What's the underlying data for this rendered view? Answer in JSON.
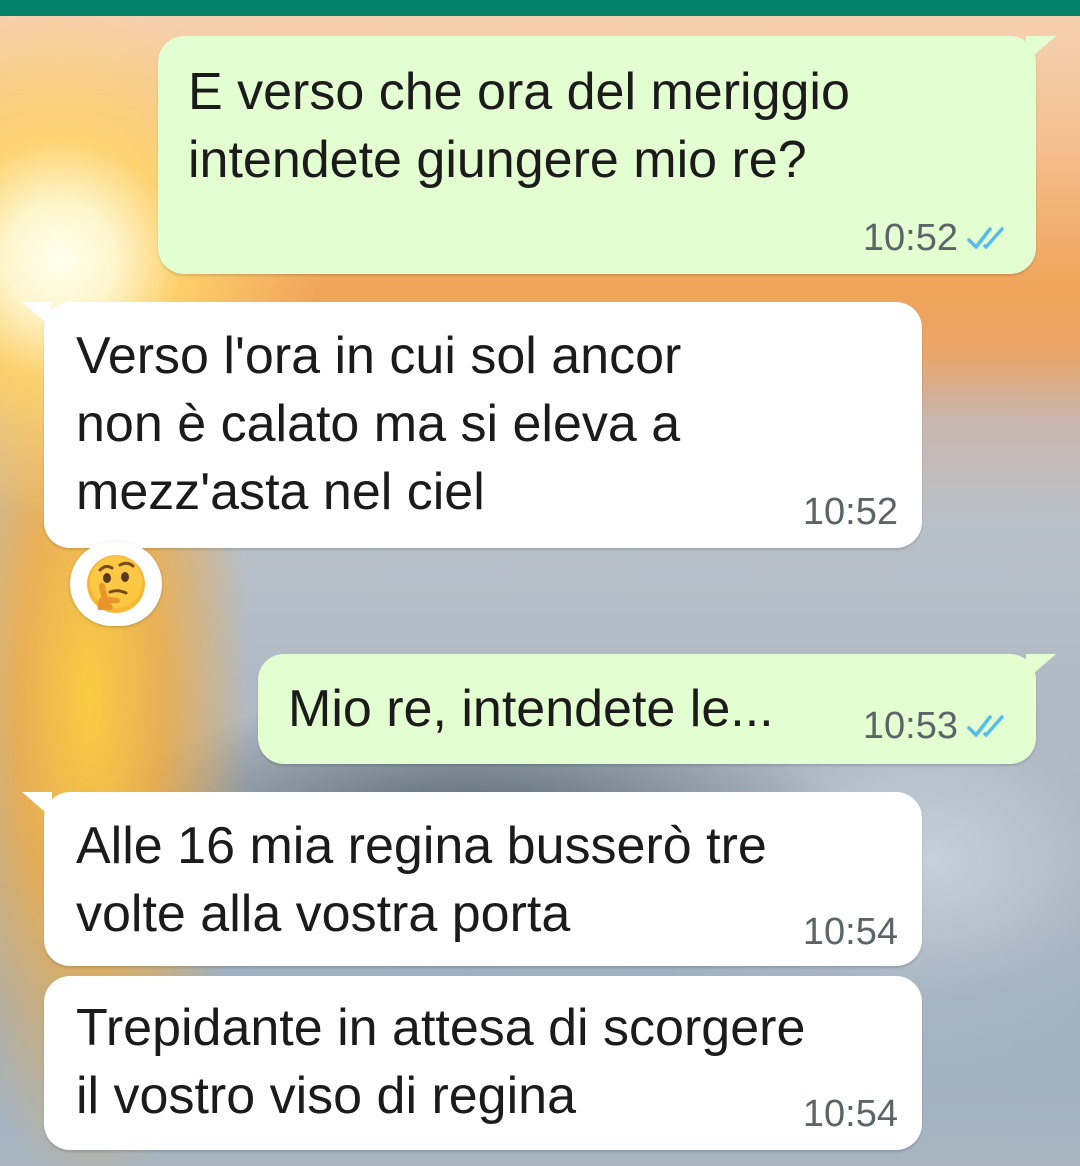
{
  "chat": {
    "messages": [
      {
        "direction": "outgoing",
        "lines": [
          "E verso che ora del meriggio",
          "intendete giungere mio re?"
        ],
        "time": "10:52",
        "status": "read"
      },
      {
        "direction": "incoming",
        "lines": [
          "Verso l'ora in cui sol ancor",
          "non è calato ma si eleva a",
          "mezz'asta nel ciel"
        ],
        "time": "10:52",
        "reaction": "thinking-face-emoji"
      },
      {
        "direction": "outgoing",
        "lines": [
          "Mio re, intendete le..."
        ],
        "time": "10:53",
        "status": "read"
      },
      {
        "direction": "incoming",
        "lines": [
          "Alle 16 mia regina busserò tre",
          "volte alla vostra porta"
        ],
        "time": "10:54"
      },
      {
        "direction": "incoming",
        "lines": [
          "Trepidante in attesa di scorgere",
          "il vostro viso di regina"
        ],
        "time": "10:54"
      }
    ]
  },
  "colors": {
    "header": "#008069",
    "outgoing_bubble": "#e3fed0",
    "incoming_bubble": "#ffffff",
    "read_ticks": "#53bdeb",
    "timestamp": "#5d6469"
  },
  "icons": {
    "read_receipt": "double-check-icon",
    "reaction": "thinking-face-emoji"
  }
}
